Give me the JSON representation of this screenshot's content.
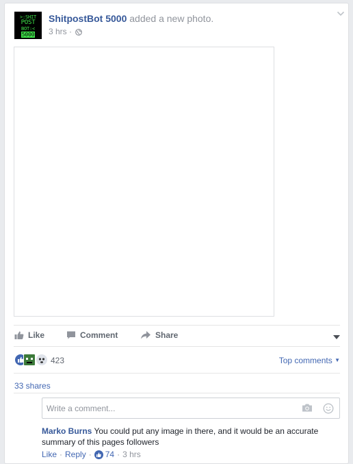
{
  "post": {
    "author": "ShitpostBot 5000",
    "action": " added a new photo.",
    "time": "3 hrs",
    "meta_sep": " · ",
    "avatar_lines": [
      ">:SHIT",
      "POST",
      "BOT:<",
      "5000"
    ]
  },
  "actions": {
    "like": "Like",
    "comment": "Comment",
    "share": "Share"
  },
  "reactions": {
    "count": "423",
    "top_comments": "Top comments"
  },
  "shares": "33 shares",
  "comment_box": {
    "placeholder": "Write a comment..."
  },
  "comment": {
    "author": "Marko Burns",
    "text": " You could put any image in there, and it would be an accurate summary of this pages followers",
    "like": "Like",
    "reply": "Reply",
    "likes": "74",
    "time": "3 hrs",
    "sep": "·"
  },
  "colors": {
    "link": "#365899",
    "accent": "#4267b2",
    "muted": "#90949c",
    "avatar_green": "#3fe44a"
  },
  "icons": [
    "globe-icon",
    "chevron-down-icon",
    "thumbs-up-icon",
    "comment-icon",
    "share-arrow-icon",
    "camera-icon",
    "emoji-icon"
  ]
}
